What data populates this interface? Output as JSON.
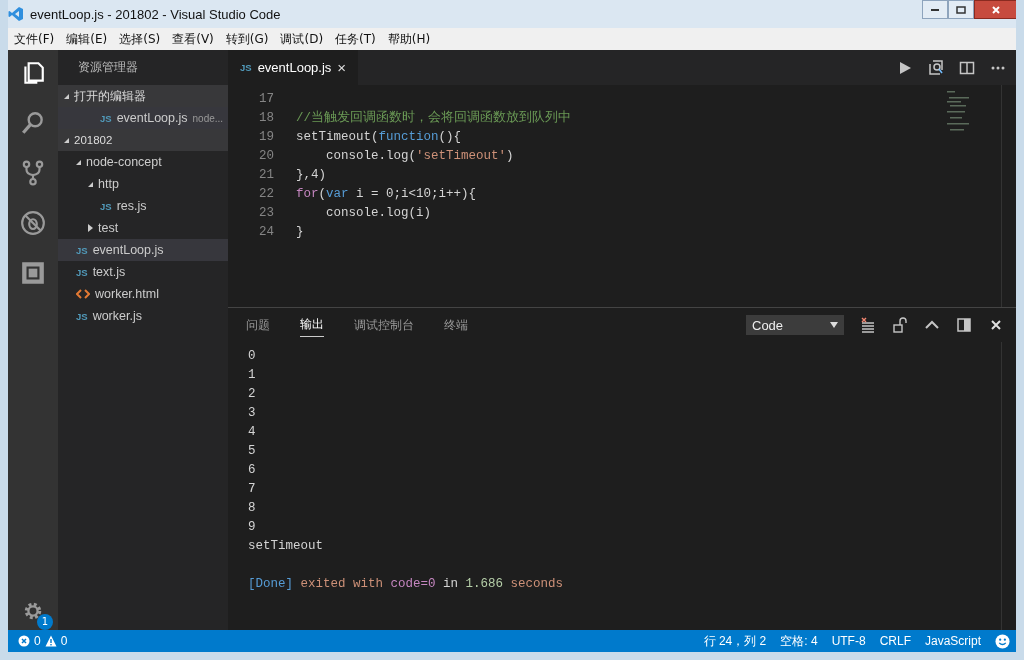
{
  "window": {
    "title": "eventLoop.js - 201802 - Visual Studio Code"
  },
  "menu": [
    "文件(F)",
    "编辑(E)",
    "选择(S)",
    "查看(V)",
    "转到(G)",
    "调试(D)",
    "任务(T)",
    "帮助(H)"
  ],
  "activity_bar": {
    "settings_badge": "1"
  },
  "sidebar": {
    "title": "资源管理器",
    "sections": [
      {
        "label": "打开的编辑器",
        "expanded": true,
        "items": [
          {
            "label": "eventLoop.js",
            "detail": "node...",
            "kind": "js",
            "badge": "JS",
            "selected": true
          }
        ]
      },
      {
        "label": "201802",
        "expanded": true,
        "items": [
          {
            "label": "node-concept",
            "kind": "folder",
            "expanded": true,
            "selected": false,
            "children": [
              {
                "label": "http",
                "kind": "folder",
                "expanded": true,
                "selected": false,
                "children": [
                  {
                    "label": "res.js",
                    "kind": "js",
                    "badge": "JS",
                    "selected": false
                  }
                ]
              },
              {
                "label": "test",
                "kind": "folder",
                "expanded": false,
                "selected": false
              }
            ]
          },
          {
            "label": "eventLoop.js",
            "kind": "js",
            "badge": "JS",
            "selected": true
          },
          {
            "label": "text.js",
            "kind": "js",
            "badge": "JS",
            "selected": false
          },
          {
            "label": "worker.html",
            "kind": "html",
            "selected": false
          },
          {
            "label": "worker.js",
            "kind": "js",
            "badge": "JS",
            "selected": false
          }
        ]
      }
    ]
  },
  "editor": {
    "tabs": [
      {
        "badge": "JS",
        "label": "eventLoop.js",
        "close": "×",
        "selected": true
      }
    ],
    "lines": [
      {
        "number": "17"
      },
      {
        "number": "18",
        "tokens": [
          {
            "kind": "comment",
            "text": "//当触发回调函数时，会将回调函数放到队列中"
          }
        ]
      },
      {
        "number": "19",
        "tokens": [
          {
            "kind": "plain",
            "text": "setTimeout("
          },
          {
            "kind": "keyword",
            "text": "function"
          },
          {
            "kind": "plain",
            "text": "(){"
          }
        ]
      },
      {
        "number": "20",
        "tokens": [
          {
            "kind": "plain",
            "text": "    console.log("
          },
          {
            "kind": "string",
            "text": "'setTimeout'"
          },
          {
            "kind": "plain",
            "text": ")"
          }
        ]
      },
      {
        "number": "21",
        "tokens": [
          {
            "kind": "plain",
            "text": "},4)"
          }
        ]
      },
      {
        "number": "22",
        "tokens": [
          {
            "kind": "control",
            "text": "for"
          },
          {
            "kind": "plain",
            "text": "("
          },
          {
            "kind": "keyword",
            "text": "var"
          },
          {
            "kind": "plain",
            "text": " i = 0;i<10;i++){"
          }
        ]
      },
      {
        "number": "23",
        "tokens": [
          {
            "kind": "plain",
            "text": "    console.log(i)"
          }
        ]
      },
      {
        "number": "24",
        "tokens": [
          {
            "kind": "plain",
            "text": "}"
          }
        ]
      }
    ]
  },
  "panel": {
    "tabs": [
      {
        "label": "问题",
        "selected": false
      },
      {
        "label": "输出",
        "selected": true
      },
      {
        "label": "调试控制台",
        "selected": false
      },
      {
        "label": "终端",
        "selected": false
      }
    ],
    "channel": "Code",
    "output": [
      {
        "tokens": [
          {
            "kind": "plain",
            "text": "0"
          }
        ]
      },
      {
        "tokens": [
          {
            "kind": "plain",
            "text": "1"
          }
        ]
      },
      {
        "tokens": [
          {
            "kind": "plain",
            "text": "2"
          }
        ]
      },
      {
        "tokens": [
          {
            "kind": "plain",
            "text": "3"
          }
        ]
      },
      {
        "tokens": [
          {
            "kind": "plain",
            "text": "4"
          }
        ]
      },
      {
        "tokens": [
          {
            "kind": "plain",
            "text": "5"
          }
        ]
      },
      {
        "tokens": [
          {
            "kind": "plain",
            "text": "6"
          }
        ]
      },
      {
        "tokens": [
          {
            "kind": "plain",
            "text": "7"
          }
        ]
      },
      {
        "tokens": [
          {
            "kind": "plain",
            "text": "8"
          }
        ]
      },
      {
        "tokens": [
          {
            "kind": "plain",
            "text": "9"
          }
        ]
      },
      {
        "tokens": [
          {
            "kind": "plain",
            "text": "setTimeout"
          }
        ]
      },
      {
        "tokens": [
          {
            "kind": "info",
            "text": "[Done]"
          },
          {
            "kind": "string",
            "text": " exited with "
          },
          {
            "kind": "keyword",
            "text": "code=0"
          },
          {
            "kind": "plain",
            "text": " in "
          },
          {
            "kind": "number",
            "text": "1.686"
          },
          {
            "kind": "string",
            "text": " seconds"
          }
        ]
      }
    ]
  },
  "status_bar": {
    "errors": "0",
    "warnings": "0",
    "items": [
      "行 24，列 2",
      "空格: 4",
      "UTF-8",
      "CRLF",
      "JavaScript"
    ]
  }
}
